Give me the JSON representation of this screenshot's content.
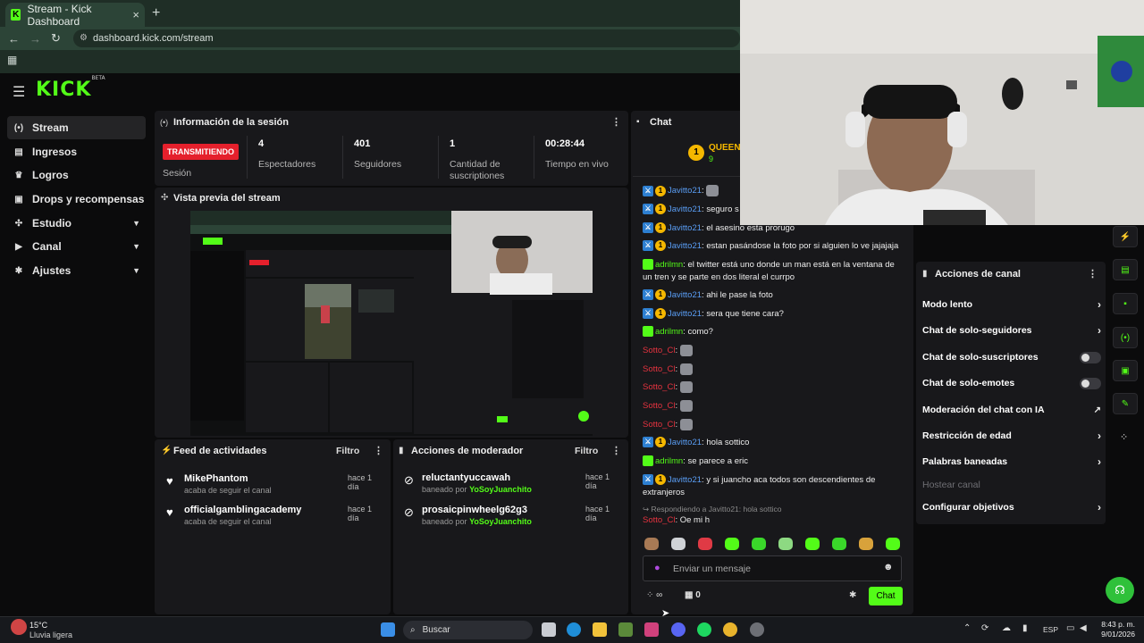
{
  "browser": {
    "tab_title": "Stream - Kick Dashboard",
    "tab_favicon": "K",
    "close": "×",
    "new_tab": "+",
    "url": "dashboard.kick.com/stream",
    "back": "←",
    "forward": "→",
    "reload": "↻"
  },
  "logo": {
    "text": "KICK",
    "sup": "BETA"
  },
  "sidebar": {
    "items": [
      {
        "label": "Stream",
        "icon": "broadcast-icon",
        "glyph": "(•)"
      },
      {
        "label": "Ingresos",
        "icon": "wallet-icon",
        "glyph": "▤"
      },
      {
        "label": "Logros",
        "icon": "trophy-icon",
        "glyph": "♛"
      },
      {
        "label": "Drops y recompensas",
        "icon": "gift-icon",
        "glyph": "▣"
      },
      {
        "label": "Estudio",
        "icon": "studio-icon",
        "glyph": "✣"
      },
      {
        "label": "Canal",
        "icon": "channel-icon",
        "glyph": "▶"
      },
      {
        "label": "Ajustes",
        "icon": "gear-icon",
        "glyph": "✱"
      }
    ],
    "chevron": "▼"
  },
  "session": {
    "title": "Información de la sesión",
    "badge": "TRANSMITIENDO",
    "badge_label": "Sesión",
    "stats": [
      {
        "value": "4",
        "label": "Espectadores"
      },
      {
        "value": "401",
        "label": "Seguidores"
      },
      {
        "value": "1",
        "label": "Cantidad de suscriptiones"
      },
      {
        "value": "00:28:44",
        "label": "Tiempo en vivo"
      }
    ]
  },
  "preview": {
    "title": "Vista previa del stream"
  },
  "feed": {
    "title": "Feed de actividades",
    "filter": "Filtro",
    "items": [
      {
        "name": "MikePhantom",
        "sub": "acaba de seguir el canal",
        "time": "hace 1 día"
      },
      {
        "name": "officialgamblingacademy",
        "sub": "acaba de seguir el canal",
        "time": "hace 1 día"
      }
    ]
  },
  "mod": {
    "title": "Acciones de moderador",
    "filter": "Filtro",
    "items": [
      {
        "name": "reluctantyuccawah",
        "sub_prefix": "baneado por",
        "by": "YoSoyJuanchito",
        "time": "hace 1 día"
      },
      {
        "name": "prosaicpinwheelg62g3",
        "sub_prefix": "baneado por",
        "by": "YoSoyJuanchito",
        "time": "hace 1 día"
      }
    ]
  },
  "chat": {
    "title": "Chat",
    "pinned_user": "QUEEN_",
    "pinned_count": "9",
    "reply_label": "Respondiendo a Javitto21: hola sottico",
    "input_placeholder": "Enviar un mensaje",
    "send_button": "Chat",
    "points": "∞",
    "gift_count": "0",
    "messages": [
      {
        "user": "Javitto21",
        "text": "",
        "emote": true
      },
      {
        "user": "Javitto21",
        "text": "seguro s"
      },
      {
        "user": "Javitto21",
        "text": "el asesino esta prorugo"
      },
      {
        "user": "Javitto21",
        "text": "estan pasándose la foto por si alguien lo ve jajajaja"
      },
      {
        "user": "adrilmn",
        "text": "el twitter está uno donde un man está en la ventana de un tren y se parte en dos literal el currpo"
      },
      {
        "user": "Javitto21",
        "text": "ahi le pase la foto"
      },
      {
        "user": "Javitto21",
        "text": "sera que tiene cara?"
      },
      {
        "user": "adrilmn",
        "text": "como?"
      },
      {
        "user": "Sotto_Cl",
        "text": "",
        "emote": true
      },
      {
        "user": "Sotto_Cl",
        "text": "",
        "emote": true
      },
      {
        "user": "Sotto_Cl",
        "text": "",
        "emote": true
      },
      {
        "user": "Sotto_Cl",
        "text": "",
        "emote": true
      },
      {
        "user": "Sotto_Cl",
        "text": "",
        "emote": true
      },
      {
        "user": "Javitto21",
        "text": "hola sottico"
      },
      {
        "user": "adrilmn",
        "text": "se parece a eric"
      },
      {
        "user": "Javitto21",
        "text": "y si juancho aca todos son descendientes de extranjeros"
      },
      {
        "user": "Sotto_Cl",
        "text": "Oe mi h"
      }
    ]
  },
  "channel_actions": {
    "title": "Acciones de canal",
    "items": [
      {
        "label": "Modo lento",
        "control": "arrow"
      },
      {
        "label": "Chat de solo-seguidores",
        "control": "arrow"
      },
      {
        "label": "Chat de solo-suscriptores",
        "control": "toggle"
      },
      {
        "label": "Chat de solo-emotes",
        "control": "toggle"
      },
      {
        "label": "Moderación del chat con IA",
        "control": "external"
      },
      {
        "label": "Restricción de edad",
        "control": "arrow"
      },
      {
        "label": "Palabras baneadas",
        "control": "arrow"
      },
      {
        "label": "Hostear canal",
        "control": "none"
      },
      {
        "label": "Configurar objetivos",
        "control": "arrow"
      }
    ]
  },
  "taskbar": {
    "temp": "15°C",
    "weather": "Lluvia ligera",
    "search": "Buscar",
    "lang": "ESP",
    "time": "8:43 p. m.",
    "date": "9/01/2026"
  },
  "colors": {
    "accent": "#53fc18",
    "live": "#e5202c",
    "panel": "#18181b"
  }
}
